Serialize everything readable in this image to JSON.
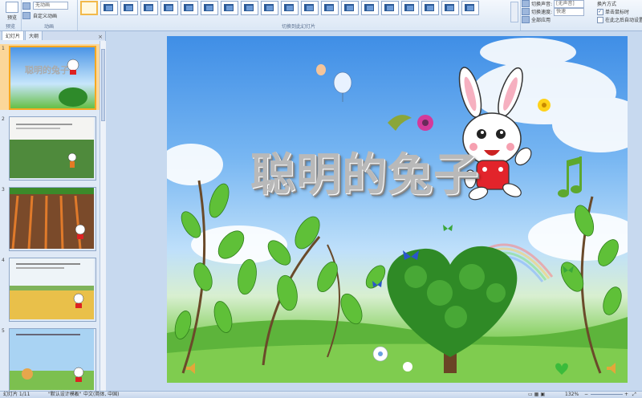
{
  "ribbon": {
    "preview_label": "预览",
    "preview_group_label": "预览",
    "animate_value": "无动画",
    "custom_animation_label": "自定义动画",
    "animation_group_label": "动画",
    "transition_group_label": "切换到此幻灯片",
    "transition_sound_label": "切换声音:",
    "transition_sound_value": "[无声音]",
    "transition_speed_label": "切换速度:",
    "transition_speed_value": "快速",
    "apply_all_label": "全部应用",
    "advance_label": "换片方式",
    "on_click_label": "单击鼠标时",
    "auto_after_label": "在此之后自动设置"
  },
  "left_pane": {
    "tab_slides": "幻灯片",
    "tab_outline": "大纲",
    "close": "×",
    "slides": [
      {
        "num": "1",
        "selected": true
      },
      {
        "num": "2",
        "selected": false
      },
      {
        "num": "3",
        "selected": false
      },
      {
        "num": "4",
        "selected": false
      },
      {
        "num": "5",
        "selected": false
      }
    ]
  },
  "slide": {
    "title": "聪明的兔子"
  },
  "status": {
    "slide_counter": "幻灯片 1/11",
    "theme": "\"默认设计模板\"",
    "language": "中文(简体, 中国)",
    "zoom": "132%"
  },
  "colors": {
    "selected_thumb_border": "#f6a821",
    "ribbon_bg": "#dbe7f5",
    "workspace_bg": "#c7d9ef"
  }
}
